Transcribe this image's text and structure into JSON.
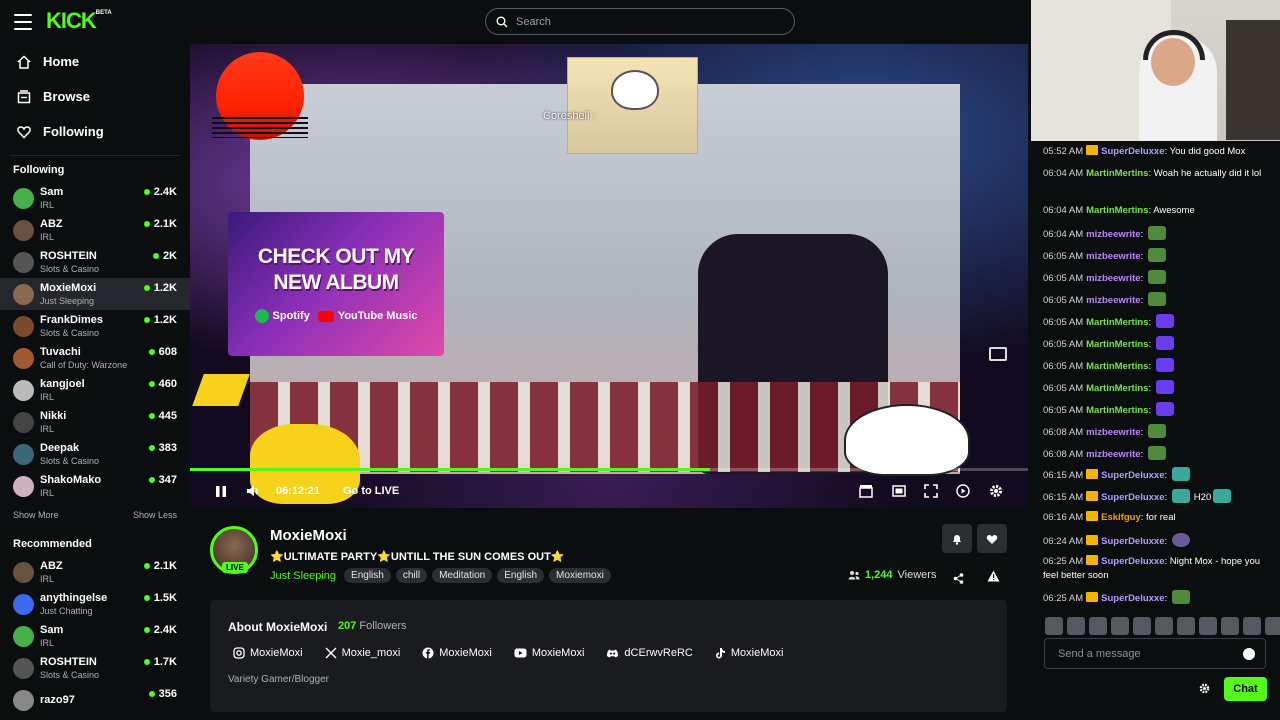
{
  "header": {
    "logo": "KICK",
    "logo_badge": "BETA",
    "search_placeholder": "Search"
  },
  "nav": [
    {
      "label": "Home"
    },
    {
      "label": "Browse"
    },
    {
      "label": "Following"
    }
  ],
  "sidebar": {
    "following_title": "Following",
    "following": [
      {
        "name": "Sam",
        "category": "IRL",
        "viewers": "2.4K",
        "color": "#46b04a"
      },
      {
        "name": "ABZ",
        "category": "IRL",
        "viewers": "2.1K",
        "color": "#6a5040"
      },
      {
        "name": "ROSHTEIN",
        "category": "Slots & Casino",
        "viewers": "2K",
        "color": "#555"
      },
      {
        "name": "MoxieMoxi",
        "category": "Just Sleeping",
        "viewers": "1.2K",
        "color": "#8a6a50"
      },
      {
        "name": "FrankDimes",
        "category": "Slots & Casino",
        "viewers": "1.2K",
        "color": "#7a4a2a"
      },
      {
        "name": "Tuvachi",
        "category": "Call of Duty: Warzone",
        "viewers": "608",
        "color": "#a05a30"
      },
      {
        "name": "kangjoel",
        "category": "IRL",
        "viewers": "460",
        "color": "#bbb"
      },
      {
        "name": "Nikki",
        "category": "IRL",
        "viewers": "445",
        "color": "#444"
      },
      {
        "name": "Deepak",
        "category": "Slots & Casino",
        "viewers": "383",
        "color": "#3a6a7a"
      },
      {
        "name": "ShakoMako",
        "category": "IRL",
        "viewers": "347",
        "color": "#d0b0c0"
      }
    ],
    "show_more": "Show More",
    "show_less": "Show Less",
    "recommended_title": "Recommended",
    "recommended": [
      {
        "name": "ABZ",
        "category": "IRL",
        "viewers": "2.1K",
        "color": "#6a5040"
      },
      {
        "name": "anythingelse",
        "category": "Just Chatting",
        "viewers": "1.5K",
        "color": "#3a6af0"
      },
      {
        "name": "Sam",
        "category": "IRL",
        "viewers": "2.4K",
        "color": "#46b04a"
      },
      {
        "name": "ROSHTEIN",
        "category": "Slots & Casino",
        "viewers": "1.7K",
        "color": "#555"
      },
      {
        "name": "razo97",
        "category": "",
        "viewers": "356",
        "color": "#888"
      }
    ]
  },
  "video": {
    "overlay_tag": "Coreshell :",
    "promo_line1": "CHECK OUT MY",
    "promo_line2": "NEW ALBUM",
    "promo_spotify": "Spotify",
    "promo_youtube": "YouTube Music",
    "time": "06:12:21",
    "go_live": "Go to LIVE",
    "progress": 0.62
  },
  "stream": {
    "name": "MoxieMoxi",
    "title": "⭐ULTIMATE PARTY⭐UNTILL THE SUN COMES OUT⭐",
    "live": "LIVE",
    "category": "Just Sleeping",
    "tags": [
      "English",
      "chill",
      "Meditation",
      "English",
      "Moxiemoxi"
    ],
    "viewers": "1,244",
    "viewers_label": "Viewers"
  },
  "about": {
    "title": "About MoxieMoxi",
    "followers": "207",
    "followers_label": "Followers",
    "socials": [
      {
        "icon": "instagram-icon",
        "label": "MoxieMoxi"
      },
      {
        "icon": "x-icon",
        "label": "Moxie_moxi"
      },
      {
        "icon": "facebook-icon",
        "label": "MoxieMoxi"
      },
      {
        "icon": "youtube-icon",
        "label": "MoxieMoxi"
      },
      {
        "icon": "discord-icon",
        "label": "dCErwvReRC"
      },
      {
        "icon": "tiktok-icon",
        "label": "MoxieMoxi"
      }
    ],
    "bio": "Variety Gamer/Blogger"
  },
  "chat": {
    "messages": [
      {
        "time": "05:52 AM",
        "user": "SuperDeluxxe",
        "text": "You did good Mox",
        "crown": true,
        "color": "lav"
      },
      {
        "time": "06:04 AM",
        "user": "MartinMertins",
        "text": "Woah he actually did it lol",
        "crown": false,
        "color": "green"
      },
      {
        "time": "06:04 AM",
        "user": "MartinMertins",
        "text": "Awesome",
        "crown": false,
        "color": "green"
      },
      {
        "time": "06:04 AM",
        "user": "mizbeewrite",
        "text": "",
        "emote": "frog",
        "crown": false,
        "color": "purple"
      },
      {
        "time": "06:05 AM",
        "user": "mizbeewrite",
        "text": "",
        "emote": "frog",
        "crown": false,
        "color": "purple"
      },
      {
        "time": "06:05 AM",
        "user": "mizbeewrite",
        "text": "",
        "emote": "frog",
        "crown": false,
        "color": "purple"
      },
      {
        "time": "06:05 AM",
        "user": "mizbeewrite",
        "text": "",
        "emote": "frog",
        "crown": false,
        "color": "purple"
      },
      {
        "time": "06:05 AM",
        "user": "MartinMertins",
        "text": "",
        "emote": "purple",
        "crown": false,
        "color": "green"
      },
      {
        "time": "06:05 AM",
        "user": "MartinMertins",
        "text": "",
        "emote": "purple",
        "crown": false,
        "color": "green"
      },
      {
        "time": "06:05 AM",
        "user": "MartinMertins",
        "text": "",
        "emote": "purple",
        "crown": false,
        "color": "green"
      },
      {
        "time": "06:05 AM",
        "user": "MartinMertins",
        "text": "",
        "emote": "purple",
        "crown": false,
        "color": "green"
      },
      {
        "time": "06:05 AM",
        "user": "MartinMertins",
        "text": "",
        "emote": "purple",
        "crown": false,
        "color": "green"
      },
      {
        "time": "06:08 AM",
        "user": "mizbeewrite",
        "text": "",
        "emote": "frog",
        "crown": false,
        "color": "purple"
      },
      {
        "time": "06:08 AM",
        "user": "mizbeewrite",
        "text": "",
        "emote": "frog",
        "crown": false,
        "color": "purple"
      },
      {
        "time": "06:15 AM",
        "user": "SuperDeluxxe",
        "text": "",
        "emote": "ghost",
        "crown": true,
        "color": "lav"
      },
      {
        "time": "06:15 AM",
        "user": "SuperDeluxxe",
        "text": "H20",
        "emote": "ghost",
        "crown": true,
        "color": "lav"
      },
      {
        "time": "06:16 AM",
        "user": "Eskifguy",
        "text": "for real",
        "crown": true,
        "color": "orange"
      },
      {
        "time": "06:24 AM",
        "user": "SuperDeluxxe",
        "text": "",
        "emote": "moon",
        "crown": true,
        "color": "lav"
      },
      {
        "time": "06:25 AM",
        "user": "SuperDeluxxe",
        "text": "Night Mox - hope you feel better soon",
        "crown": true,
        "color": "lav"
      },
      {
        "time": "06:25 AM",
        "user": "SuperDeluxxe",
        "text": "",
        "emote": "frog",
        "crown": true,
        "color": "lav"
      }
    ],
    "input_placeholder": "Send a message",
    "send_label": "Chat"
  }
}
